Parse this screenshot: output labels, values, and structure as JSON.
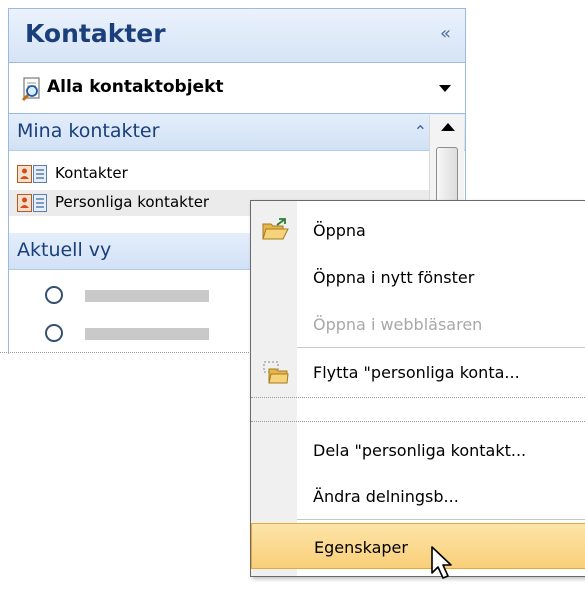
{
  "nav": {
    "title": "Kontakter",
    "collapse_glyph": "«",
    "view_selector": {
      "icon": "contact-search-icon",
      "label": "Alla kontaktobjekt"
    },
    "mina_kontakter": {
      "title": "Mina kontakter",
      "collapse_glyph": "⌃",
      "items": [
        {
          "label": "Kontakter",
          "icon": "contact-card-icon"
        },
        {
          "label": "Personliga kontakter",
          "icon": "contact-card-icon"
        }
      ]
    },
    "aktuell_vy": {
      "title": "Aktuell vy"
    }
  },
  "context_menu": {
    "items": [
      {
        "label": "Öppna",
        "icon": "open-folder-icon",
        "state": "normal"
      },
      {
        "label": "Öppna i nytt fönster",
        "state": "normal"
      },
      {
        "label": "Öppna i webbläsaren",
        "state": "disabled"
      },
      {
        "label": "Flytta \"personliga konta...",
        "icon": "move-folder-icon",
        "state": "normal"
      },
      {
        "label": "Dela \"personliga kontakt...",
        "state": "normal"
      },
      {
        "label": "Ändra delningsb...",
        "state": "normal"
      },
      {
        "label": "Egenskaper",
        "state": "highlighted"
      }
    ]
  },
  "colors": {
    "header_text": "#1a3f7a",
    "pane_border": "#9db9de",
    "highlight": "#f9cf79"
  }
}
